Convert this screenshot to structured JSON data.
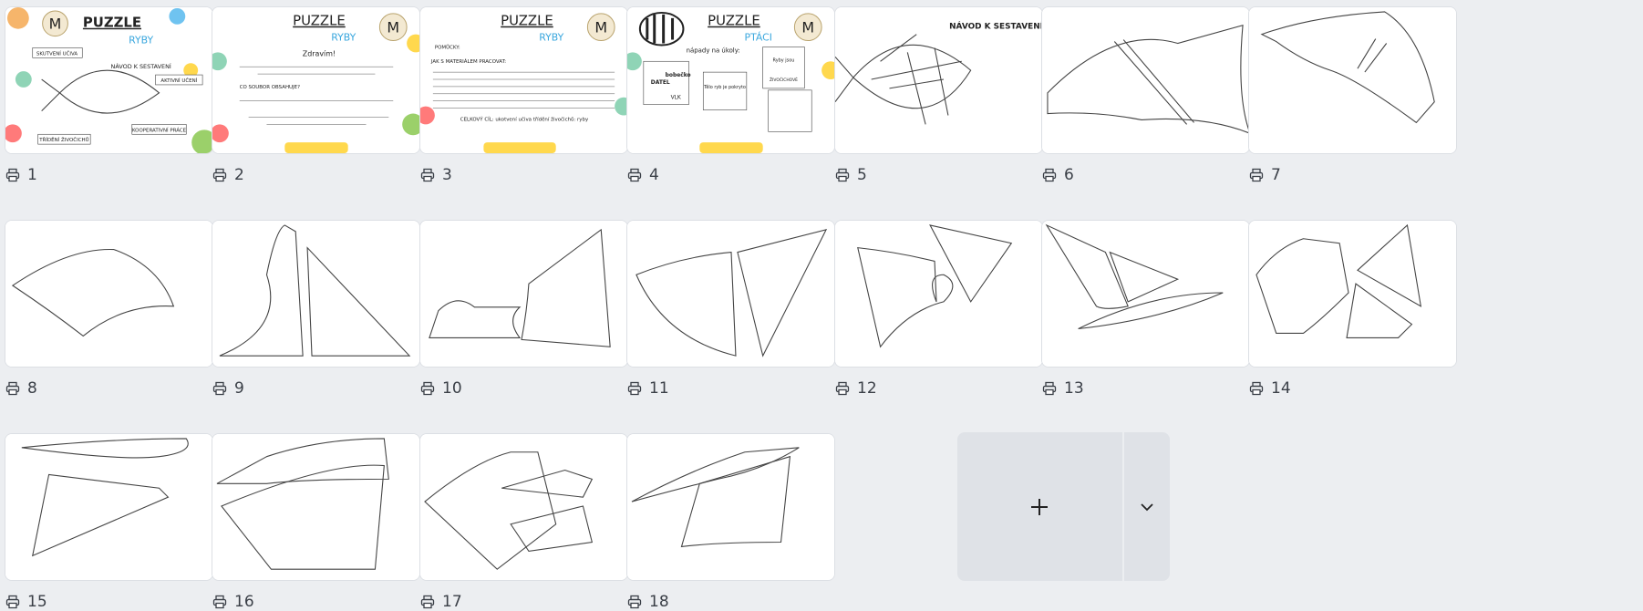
{
  "pages": [
    {
      "number": "1"
    },
    {
      "number": "2"
    },
    {
      "number": "3"
    },
    {
      "number": "4"
    },
    {
      "number": "5"
    },
    {
      "number": "6"
    },
    {
      "number": "7"
    },
    {
      "number": "8"
    },
    {
      "number": "9"
    },
    {
      "number": "10"
    },
    {
      "number": "11"
    },
    {
      "number": "12"
    },
    {
      "number": "13"
    },
    {
      "number": "14"
    },
    {
      "number": "15"
    },
    {
      "number": "16"
    },
    {
      "number": "17"
    },
    {
      "number": "18"
    }
  ],
  "thumb_text": {
    "puzzle": "PUZZLE",
    "ryby": "RYBY",
    "ptaci": "PTÁCI",
    "zdravim": "Zdravím!",
    "navod": "NÁVOD K SESTAVENÍ",
    "napady": "nápady na úkoly:",
    "pomucky": "POMŮCKY:",
    "jak": "JAK S MATERIÁLEM PRACOVAT:",
    "co_soubor": "CO SOUBOR OBSAHUJE?",
    "celkovy": "CELKOVÝ CÍL: ukotvení učiva třídění živočichů: ryby",
    "tag_skutecni": "SKUTVENÍ UČIVA",
    "tag_navod": "NÁVOD K SESTAVENÍ",
    "tag_aktivni": "AKTIVNÍ UČENÍ",
    "tag_trideni": "TŘÍDĚNÍ ŽIVOČICHŮ",
    "tag_koop": "KOOPERATIVNÍ PRÁCE",
    "w_datel": "DATEL",
    "w_bobeiko": "bobečko",
    "w_vlk": "VLK",
    "w_ryby": "Ryby jsou",
    "w_zivocichove": "ŽIVOČICHOVÉ",
    "w_telo": "Tělo ryb je pokryto"
  },
  "actions": {
    "add_icon": "plus-icon",
    "more_icon": "chevron-down-icon"
  },
  "colors": {
    "background": "#eceef1",
    "card": "#ffffff",
    "accent_blue": "#3aa7de",
    "add_tile": "#dfe2e7"
  }
}
